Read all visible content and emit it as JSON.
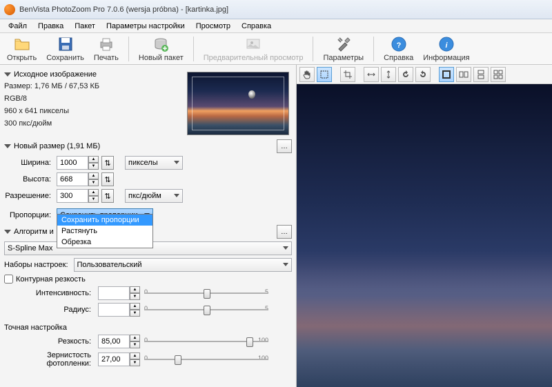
{
  "window": {
    "title": "BenVista PhotoZoom Pro 7.0.6 (wersja próbna) - [kartinka.jpg]"
  },
  "menu": {
    "file": "Файл",
    "edit": "Правка",
    "batch": "Пакет",
    "params": "Параметры настройки",
    "view": "Просмотр",
    "help": "Справка"
  },
  "toolbar": {
    "open": "Открыть",
    "save": "Сохранить",
    "print": "Печать",
    "newbatch": "Новый пакет",
    "preview": "Предварительный просмотр",
    "params": "Параметры",
    "help": "Справка",
    "info": "Информация"
  },
  "source": {
    "title": "Исходное изображение",
    "size": "Размер: 1,76 МБ / 67,53 КБ",
    "mode": "RGB/8",
    "dim": "960 x 641 пикселы",
    "dpi": "300 пкс/дюйм"
  },
  "newsize": {
    "title": "Новый размер (1,91 МБ)",
    "width_lbl": "Ширина:",
    "width_val": "1000",
    "height_lbl": "Высота:",
    "height_val": "668",
    "res_lbl": "Разрешение:",
    "res_val": "300",
    "units_px": "пикселы",
    "units_dpi": "пкс/дюйм",
    "prop_lbl": "Пропорции:",
    "prop_val": "Сохранить пропорции",
    "prop_opts": {
      "keep": "Сохранить пропорции",
      "stretch": "Растянуть",
      "crop": "Обрезка"
    }
  },
  "algo": {
    "title": "Алгоритм и",
    "method": "S-Spline Max"
  },
  "presets": {
    "lbl": "Наборы настроек:",
    "val": "Пользовательский"
  },
  "contour": {
    "lbl": "Контурная резкость",
    "intensity_lbl": "Интенсивность:",
    "radius_lbl": "Радиус:"
  },
  "fine": {
    "title": "Точная настройка",
    "sharp_lbl": "Резкость:",
    "sharp_val": "85,00",
    "grain_lbl": "Зернистость фотопленки:",
    "grain_val": "27,00"
  },
  "ticks": {
    "zero": "0",
    "five": "5",
    "hundred": "100"
  }
}
